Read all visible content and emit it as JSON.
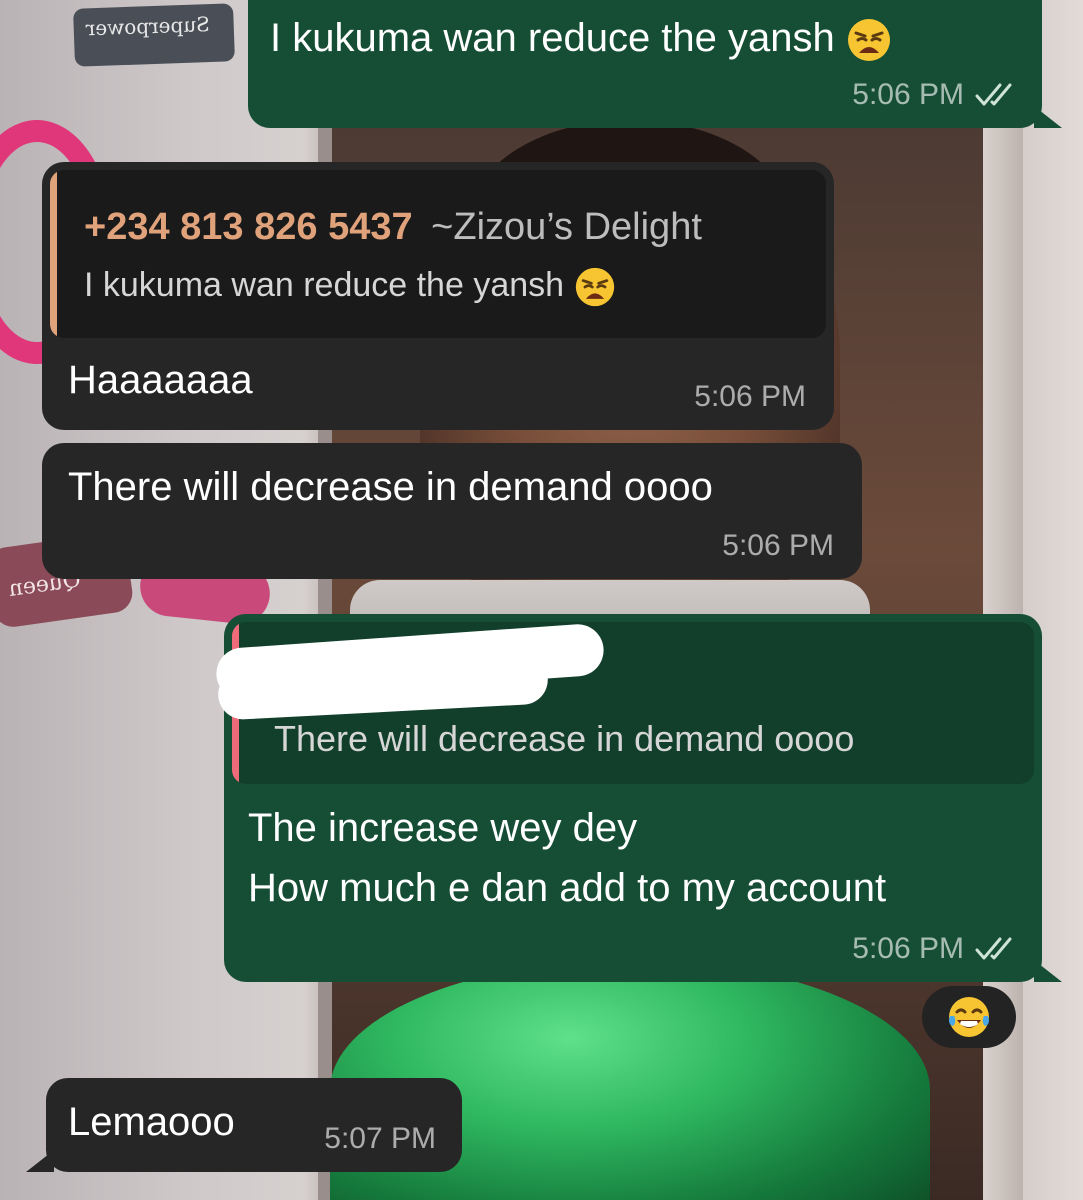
{
  "wallpaper": {
    "sticker_top_text": "Superpower",
    "sticker_mid_text": "Queen"
  },
  "messages": [
    {
      "direction": "outgoing",
      "text": "I kukuma wan reduce the yansh",
      "emoji": "weary-face",
      "time": "5:06 PM",
      "status": "read"
    },
    {
      "direction": "incoming",
      "quote": {
        "author_number": "+234 813 826 5437",
        "author_alias": "~Zizou’s Delight",
        "text": "I kukuma wan reduce the yansh",
        "emoji": "weary-face"
      },
      "text": "Haaaaaaa",
      "time": "5:06 PM"
    },
    {
      "direction": "incoming",
      "text": "There will decrease in demand oooo",
      "time": "5:06 PM"
    },
    {
      "direction": "outgoing",
      "quote": {
        "author_redacted": true,
        "text": "There will decrease in demand oooo"
      },
      "line1": "The increase wey dey",
      "line2": "How much e dan add to my account",
      "time": "5:06 PM",
      "status": "read",
      "reaction": "face-with-tears-of-joy"
    },
    {
      "direction": "incoming",
      "text": "Lemaooo",
      "time": "5:07 PM"
    }
  ],
  "colors": {
    "outgoing_bubble": "#154e35",
    "incoming_bubble": "#262626",
    "quote_author_number": "#e0a27a",
    "quote_bar_incoming": "#e0a27a",
    "quote_bar_outgoing": "#f06b7a",
    "read_ticks": "#cfe3d8"
  }
}
